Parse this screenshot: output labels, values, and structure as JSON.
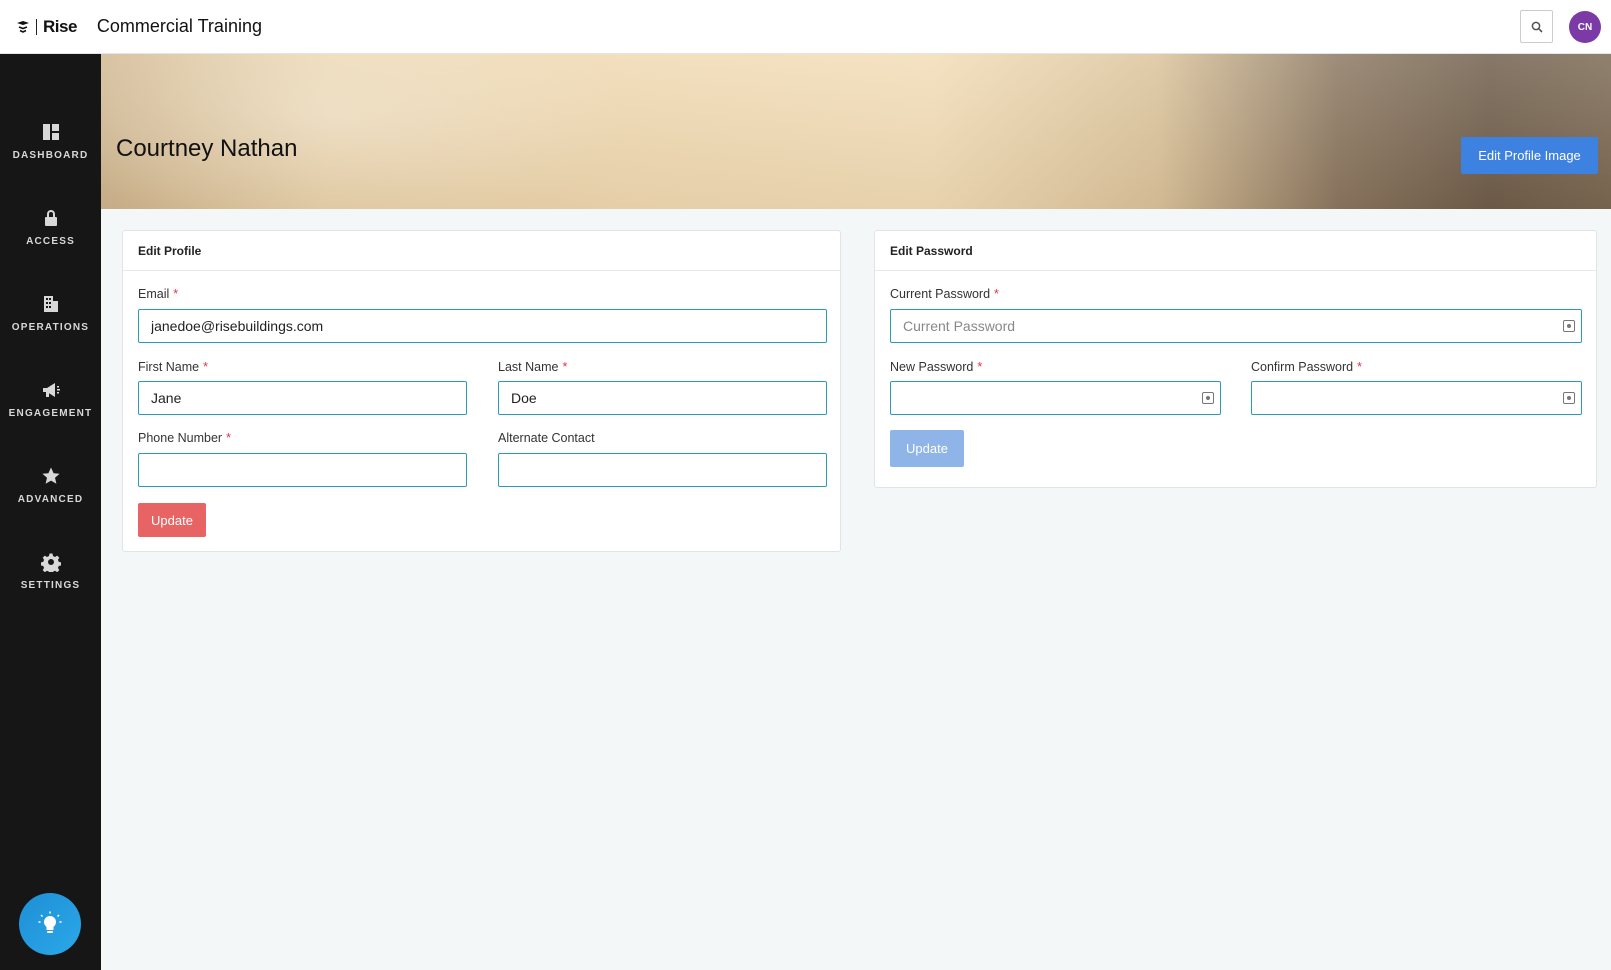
{
  "header": {
    "logo_text": "Rise",
    "app_title": "Commercial Training",
    "avatar_initials": "CN",
    "avatar_color": "#7b3aa6"
  },
  "sidebar": {
    "items": [
      {
        "label": "DASHBOARD",
        "icon": "dashboard-icon"
      },
      {
        "label": "ACCESS",
        "icon": "lock-icon"
      },
      {
        "label": "OPERATIONS",
        "icon": "building-icon"
      },
      {
        "label": "ENGAGEMENT",
        "icon": "megaphone-icon"
      },
      {
        "label": "ADVANCED",
        "icon": "star-icon"
      },
      {
        "label": "SETTINGS",
        "icon": "gear-icon"
      }
    ],
    "help_icon": "lightbulb-icon"
  },
  "banner": {
    "name": "Courtney Nathan",
    "edit_image_label": "Edit Profile Image"
  },
  "edit_profile": {
    "title": "Edit Profile",
    "email_label": "Email",
    "email_value": "janedoe@risebuildings.com",
    "first_name_label": "First Name",
    "first_name_value": "Jane",
    "last_name_label": "Last Name",
    "last_name_value": "Doe",
    "phone_label": "Phone Number",
    "phone_value": "",
    "alt_contact_label": "Alternate Contact",
    "alt_contact_value": "",
    "update_label": "Update",
    "required_mark": "*"
  },
  "edit_password": {
    "title": "Edit Password",
    "current_label": "Current Password",
    "current_placeholder": "Current Password",
    "new_label": "New Password",
    "confirm_label": "Confirm Password",
    "update_label": "Update",
    "required_mark": "*"
  },
  "colors": {
    "accent_blue": "#3d82e0",
    "danger_red": "#e86464",
    "input_border": "#2a9db5",
    "sidebar_bg": "#161616"
  }
}
